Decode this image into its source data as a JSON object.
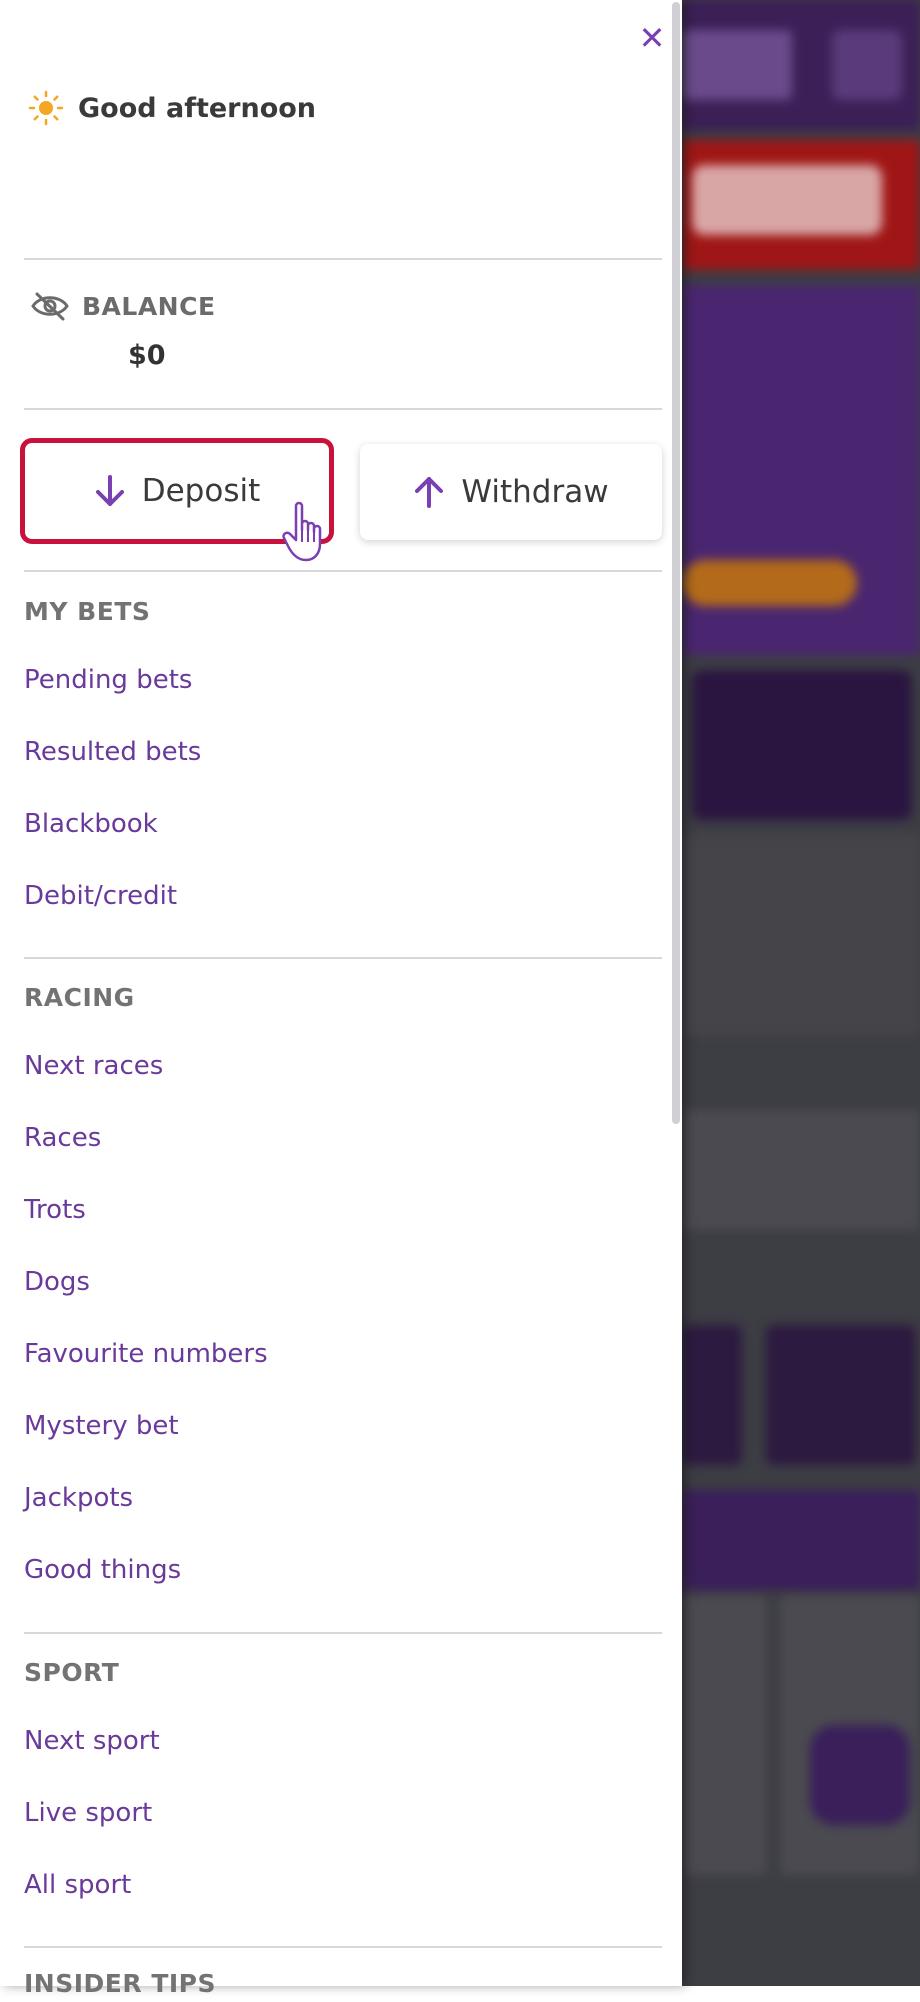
{
  "drawer": {
    "close_icon": "close-icon",
    "greeting": {
      "icon": "sun-icon",
      "text": "Good afternoon"
    },
    "balance": {
      "icon": "eye-off-icon",
      "label": "BALANCE",
      "value": "$0"
    },
    "actions": {
      "deposit_label": "Deposit",
      "withdraw_label": "Withdraw"
    },
    "sections": [
      {
        "title": "MY BETS",
        "items": [
          "Pending bets",
          "Resulted bets",
          "Blackbook",
          "Debit/credit"
        ]
      },
      {
        "title": "RACING",
        "items": [
          "Next races",
          "Races",
          "Trots",
          "Dogs",
          "Favourite numbers",
          "Mystery bet",
          "Jackpots",
          "Good things"
        ]
      },
      {
        "title": "SPORT",
        "items": [
          "Next sport",
          "Live sport",
          "All sport"
        ]
      },
      {
        "title": "INSIDER TIPS",
        "items": []
      }
    ]
  },
  "colors": {
    "accent_purple": "#7a3fb0",
    "link_purple": "#6a3a9b",
    "highlight_red": "#c8123c",
    "sun_orange": "#f5a623"
  }
}
